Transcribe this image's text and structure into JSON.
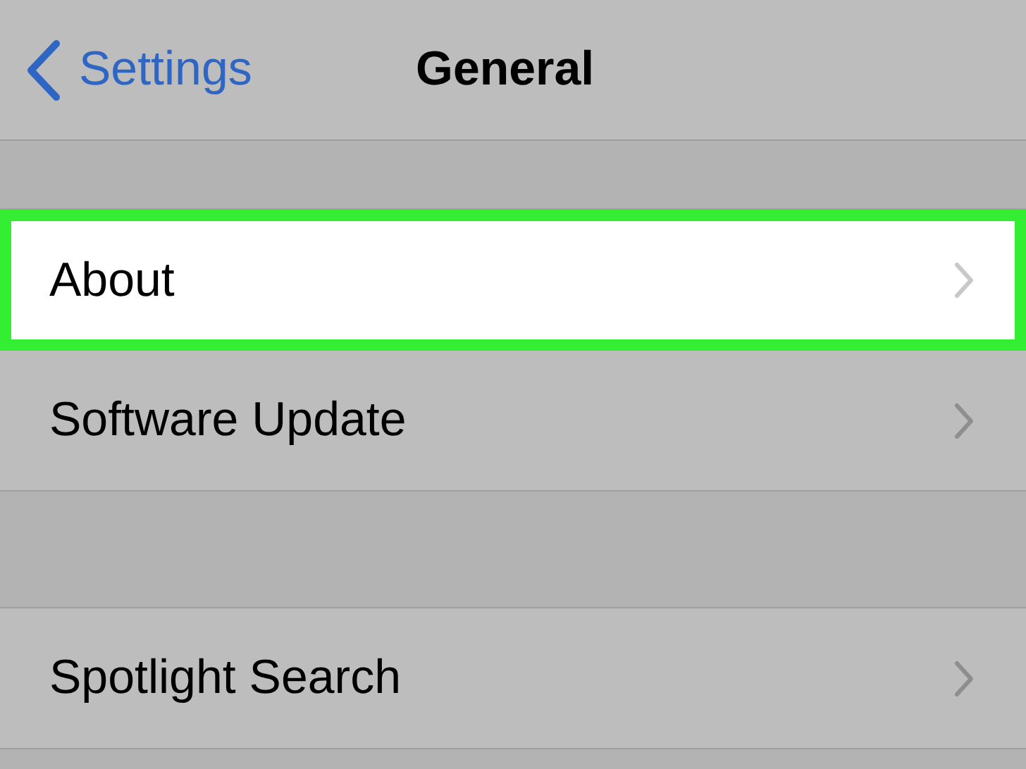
{
  "nav_bar": {
    "back_label": "Settings",
    "title": "General"
  },
  "sections": [
    {
      "rows": [
        {
          "label": "About",
          "highlighted": true
        },
        {
          "label": "Software Update",
          "highlighted": false
        }
      ]
    },
    {
      "rows": [
        {
          "label": "Spotlight Search",
          "highlighted": false
        }
      ]
    }
  ]
}
